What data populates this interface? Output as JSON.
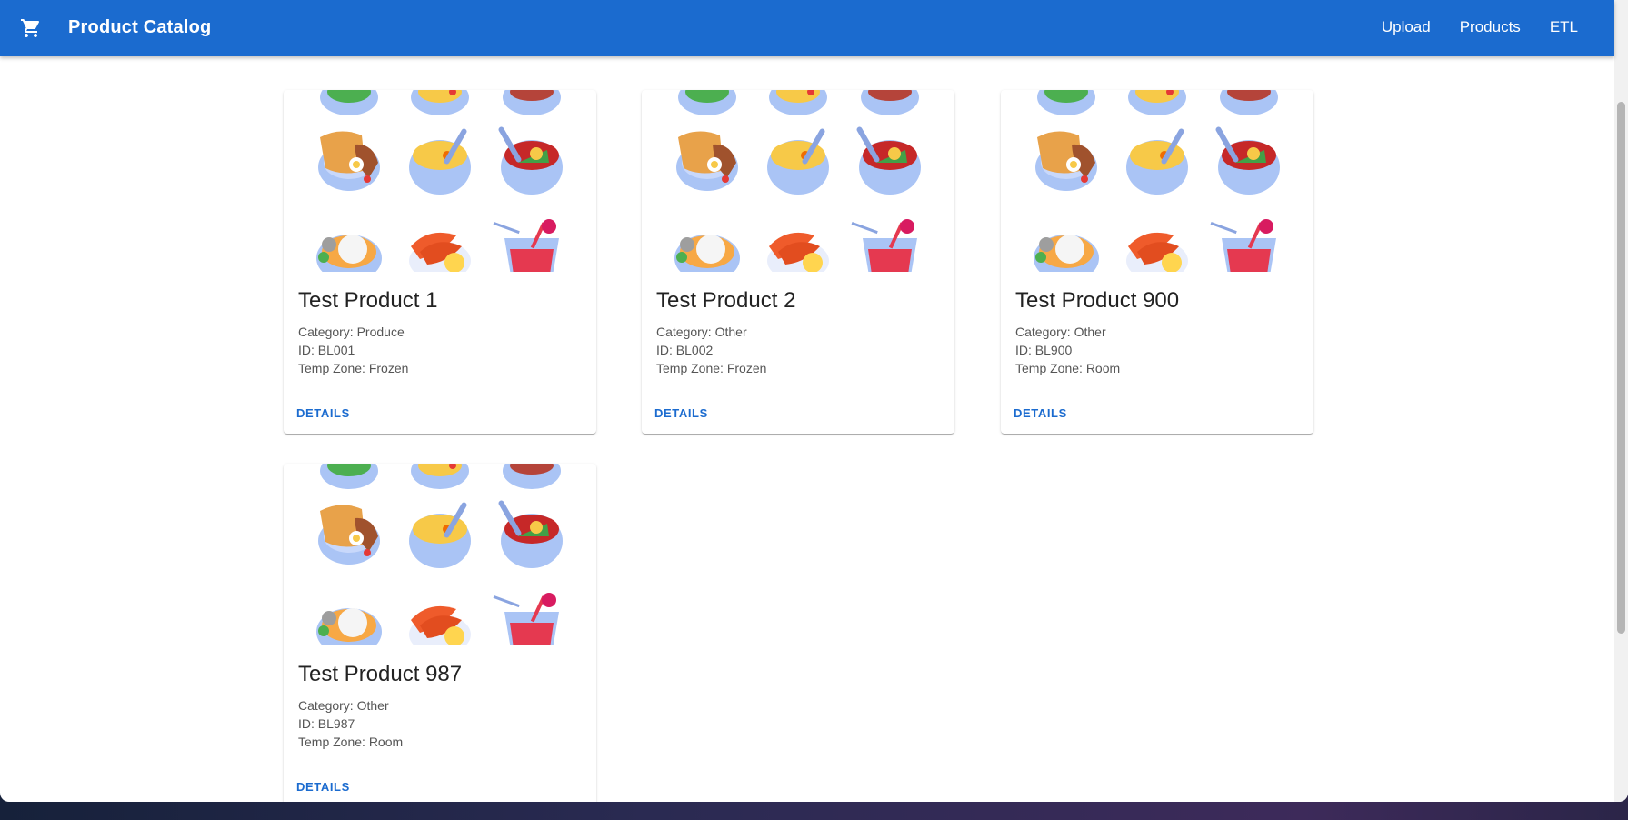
{
  "app": {
    "title": "Product Catalog",
    "cart_icon": "shopping-cart-icon",
    "nav": {
      "upload": "Upload",
      "products": "Products",
      "etl": "ETL"
    }
  },
  "colors": {
    "appbar": "#1b6bcf",
    "link": "#1b6bcf"
  },
  "products": [
    {
      "title": "Test Product 1",
      "category": "Category: Produce",
      "id": "ID: BL001",
      "temp": "Temp Zone: Frozen",
      "action": "DETAILS"
    },
    {
      "title": "Test Product 2",
      "category": "Category: Other",
      "id": "ID: BL002",
      "temp": "Temp Zone: Frozen",
      "action": "DETAILS"
    },
    {
      "title": "Test Product 900",
      "category": "Category: Other",
      "id": "ID: BL900",
      "temp": "Temp Zone: Room",
      "action": "DETAILS"
    },
    {
      "title": "Test Product 987",
      "category": "Category: Other",
      "id": "ID: BL987",
      "temp": "Temp Zone: Room",
      "action": "DETAILS"
    }
  ]
}
